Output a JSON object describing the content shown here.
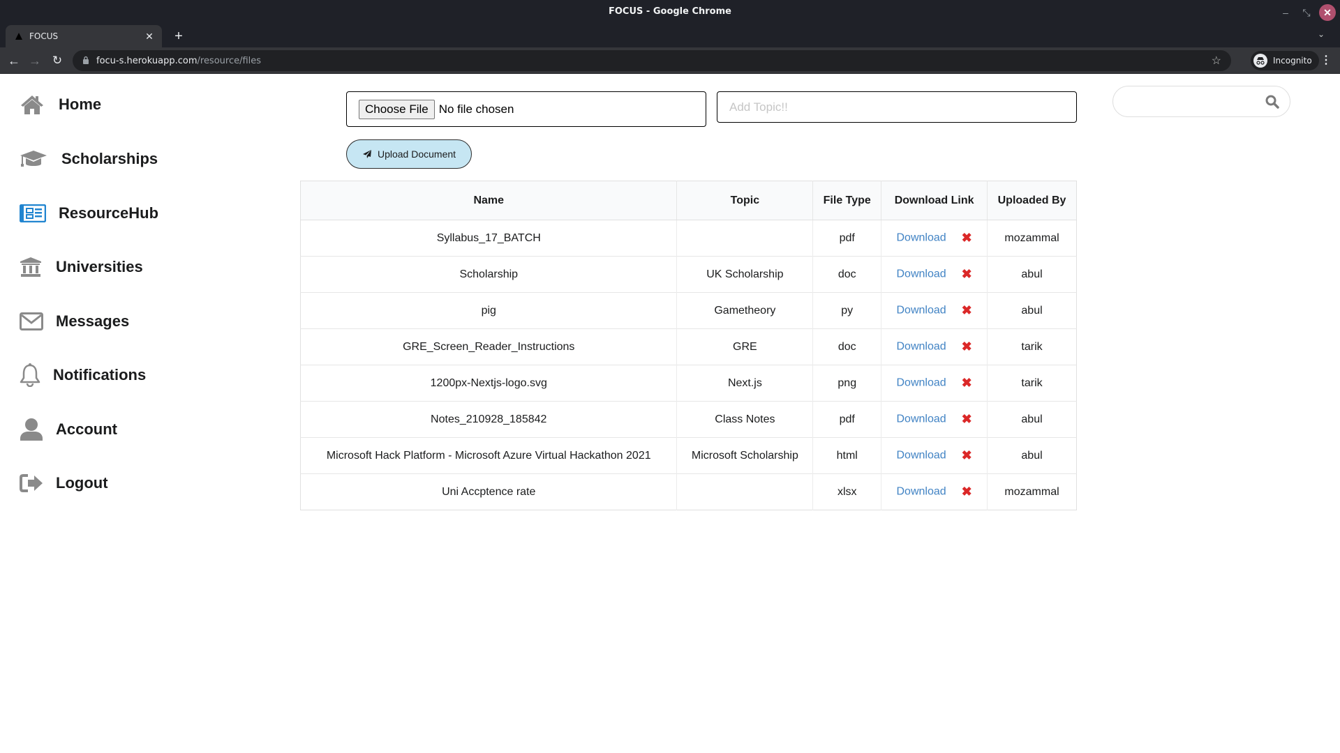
{
  "window": {
    "title": "FOCUS - Google Chrome",
    "controls": {
      "minimize": "–",
      "restore": "⤡",
      "close": "✕"
    }
  },
  "browser": {
    "tab": {
      "title": "FOCUS",
      "close": "✕"
    },
    "new_tab": "+",
    "tab_list": "⌄",
    "url_host": "focu-s.herokuapp.com",
    "url_path": "/resource/files",
    "profile_label": "Incognito",
    "icons": {
      "back": "←",
      "forward": "→",
      "reload": "↻",
      "lock": "🔒",
      "star": "☆",
      "menu": "⋮"
    }
  },
  "sidebar": {
    "items": [
      {
        "label": "Home",
        "icon": "home-icon"
      },
      {
        "label": "Scholarships",
        "icon": "graduation-cap-icon"
      },
      {
        "label": "ResourceHub",
        "icon": "newspaper-icon",
        "active": true
      },
      {
        "label": "Universities",
        "icon": "university-icon"
      },
      {
        "label": "Messages",
        "icon": "envelope-icon"
      },
      {
        "label": "Notifications",
        "icon": "bell-icon"
      },
      {
        "label": "Account",
        "icon": "user-icon"
      },
      {
        "label": "Logout",
        "icon": "sign-out-icon"
      }
    ]
  },
  "upload_form": {
    "choose_file_label": "Choose File",
    "file_status": "No file chosen",
    "topic_placeholder": "Add Topic!!",
    "topic_value": "",
    "upload_label": "Upload Document"
  },
  "search": {
    "placeholder": "",
    "value": ""
  },
  "colors": {
    "link": "#4183c4",
    "delete": "#db2828",
    "active_icon": "#2185d0",
    "upload_button_bg": "#c6e6f3"
  },
  "table": {
    "headers": [
      "Name",
      "Topic",
      "File Type",
      "Download Link",
      "Uploaded By"
    ],
    "download_label": "Download",
    "delete_glyph": "✖",
    "rows": [
      {
        "name": "Syllabus_17_BATCH",
        "topic": "",
        "type": "pdf",
        "by": "mozammal"
      },
      {
        "name": "Scholarship",
        "topic": "UK Scholarship",
        "type": "doc",
        "by": "abul"
      },
      {
        "name": "pig",
        "topic": "Gametheory",
        "type": "py",
        "by": "abul"
      },
      {
        "name": "GRE_Screen_Reader_Instructions",
        "topic": "GRE",
        "type": "doc",
        "by": "tarik"
      },
      {
        "name": "1200px-Nextjs-logo.svg",
        "topic": "Next.js",
        "type": "png",
        "by": "tarik"
      },
      {
        "name": "Notes_210928_185842",
        "topic": "Class Notes",
        "type": "pdf",
        "by": "abul"
      },
      {
        "name": "Microsoft Hack Platform - Microsoft Azure Virtual Hackathon 2021",
        "topic": "Microsoft Scholarship",
        "type": "html",
        "by": "abul"
      },
      {
        "name": "Uni Accptence rate",
        "topic": "",
        "type": "xlsx",
        "by": "mozammal"
      }
    ]
  }
}
